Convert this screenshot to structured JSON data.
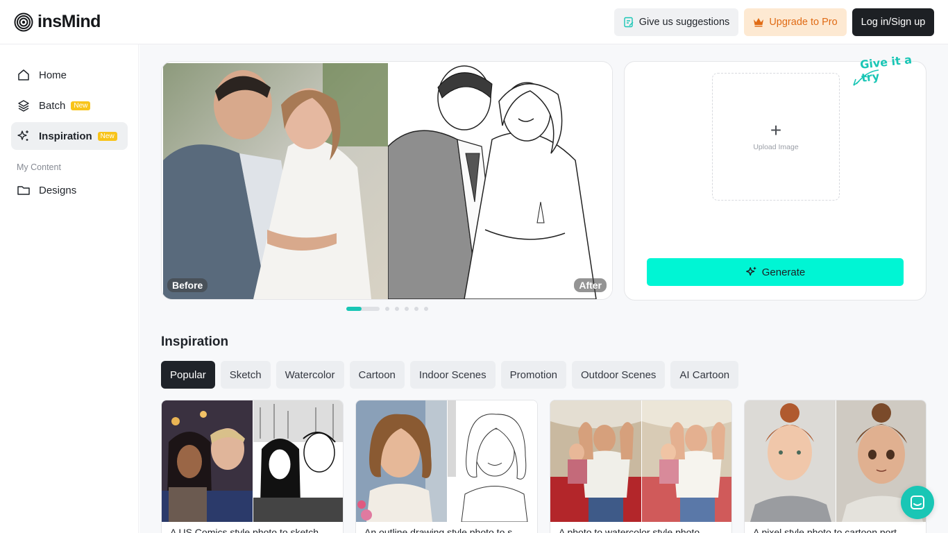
{
  "app": {
    "name": "insMind"
  },
  "header": {
    "suggest_label": "Give us suggestions",
    "upgrade_label": "Upgrade to Pro",
    "login_label": "Log in/Sign up"
  },
  "sidebar": {
    "items": [
      {
        "label": "Home",
        "icon": "home-icon"
      },
      {
        "label": "Batch",
        "icon": "layers-icon",
        "badge": "New"
      },
      {
        "label": "Inspiration",
        "icon": "sparkle-icon",
        "badge": "New",
        "active": true
      }
    ],
    "section_label": "My Content",
    "content_items": [
      {
        "label": "Designs",
        "icon": "folder-icon"
      }
    ]
  },
  "preview": {
    "before_label": "Before",
    "after_label": "After",
    "carousel_dots": 6
  },
  "upload": {
    "prompt": "Upload Image",
    "try_label": "Give it a try",
    "generate_label": "Generate"
  },
  "inspiration": {
    "title": "Inspiration",
    "categories": [
      "Popular",
      "Sketch",
      "Watercolor",
      "Cartoon",
      "Indoor Scenes",
      "Promotion",
      "Outdoor Scenes",
      "AI Cartoon"
    ],
    "active_category": "Popular",
    "cards": [
      {
        "caption": "A US Comics style photo to sketch"
      },
      {
        "caption": "An outline drawing style photo to s"
      },
      {
        "caption": "A photo to watercolor style photo"
      },
      {
        "caption": "A pixel style photo to cartoon port"
      }
    ]
  },
  "colors": {
    "accent": "#19c6b5",
    "generate": "#00f5d4",
    "upgrade": "#e06b15"
  }
}
